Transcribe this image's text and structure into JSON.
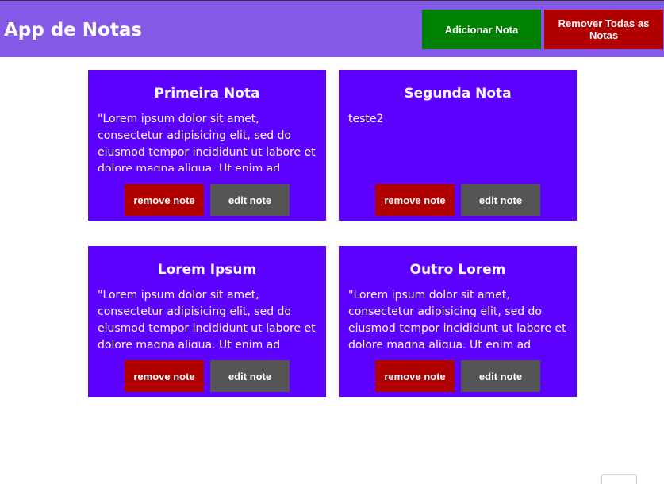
{
  "header": {
    "title": "App de Notas",
    "add_label": "Adicionar Nota",
    "clear_label": "Remover Todas as Notas"
  },
  "colors": {
    "header_bg": "#8459e6",
    "note_bg": "#5c00ff",
    "add_button": "#008000",
    "remove_button": "#b00000",
    "edit_button": "#555555"
  },
  "notes": [
    {
      "title": "Primeira Nota",
      "body": "\"Lorem ipsum dolor sit amet, consectetur adipisicing elit, sed do eiusmod tempor incididunt ut labore et dolore magna aliqua. Ut enim ad minim veniam",
      "remove_label": "remove note",
      "edit_label": "edit note"
    },
    {
      "title": "Segunda Nota",
      "body": "teste2",
      "remove_label": "remove note",
      "edit_label": "edit note"
    },
    {
      "title": "Lorem Ipsum",
      "body": "\"Lorem ipsum dolor sit amet, consectetur adipisicing elit, sed do eiusmod tempor incididunt ut labore et dolore magna aliqua. Ut enim ad minim veniam",
      "remove_label": "remove note",
      "edit_label": "edit note"
    },
    {
      "title": "Outro Lorem",
      "body": "\"Lorem ipsum dolor sit amet, consectetur adipisicing elit, sed do eiusmod tempor incididunt ut labore et dolore magna aliqua. Ut enim ad minim veniam",
      "remove_label": "remove note",
      "edit_label": "edit note"
    }
  ]
}
